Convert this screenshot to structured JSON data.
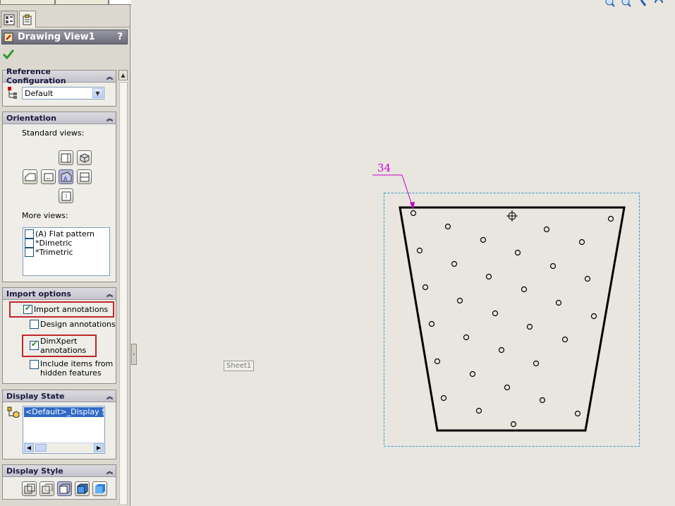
{
  "property_manager": {
    "title": "Drawing View1",
    "help": "?",
    "reference_configuration": {
      "header": "Reference Configuration",
      "selected": "Default"
    },
    "orientation": {
      "header": "Orientation",
      "standard_views_label": "Standard views:",
      "more_views_label": "More views:",
      "more_views": [
        "(A) Flat pattern",
        "*Dimetric",
        "*Trimetric"
      ]
    },
    "import_options": {
      "header": "Import options",
      "import_annotations": {
        "label": "Import annotations",
        "checked": true
      },
      "design_annotations": {
        "label": "Design annotations",
        "checked": false
      },
      "dimxpert_annotations": {
        "label_line1": "DimXpert",
        "label_line2": "annotations",
        "checked": true
      },
      "include_hidden": {
        "label_line1": "Include items from",
        "label_line2": "hidden features",
        "checked": false
      }
    },
    "display_state": {
      "header": "Display State",
      "selected": "<Default>_Display Stat"
    },
    "display_style": {
      "header": "Display Style"
    }
  },
  "drawing": {
    "sheet_label": "Sheet1",
    "dimension_value": "34"
  },
  "colors": {
    "accent_magenta": "#c800c8",
    "highlight_red": "#c2272d",
    "selection_blue": "#316ac5",
    "view_boundary": "#3399cc"
  },
  "icons": [
    "featuremanager-icon",
    "propertymanager-icon",
    "drawing-view-icon",
    "ok-check-icon",
    "configuration-icon",
    "display-state-icon",
    "zoom-icon"
  ]
}
